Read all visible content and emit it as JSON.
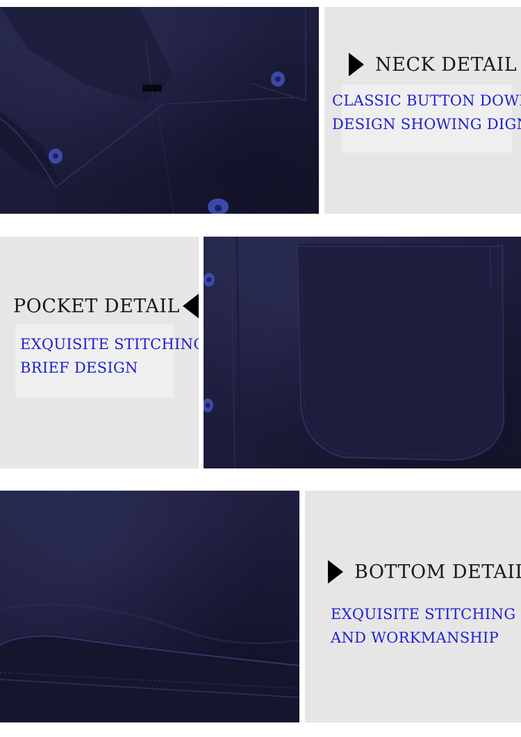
{
  "colors": {
    "fabric": "#1c1d3b",
    "panel_grey": "#e6e6e6",
    "heading_text": "#1a1a1a",
    "description_text": "#1f1fd0",
    "button": "#3b4aa8"
  },
  "sections": {
    "neck": {
      "title": "NECK DETAIL",
      "line1": "CLASSIC BUTTON DOWN",
      "line2": "DESIGN SHOWING DIGNITY",
      "icon": "triangle-right-icon"
    },
    "pocket": {
      "title": "POCKET DETAIL",
      "line1": "EXQUISITE STITCHING",
      "line2": "BRIEF DESIGN",
      "icon": "triangle-left-icon"
    },
    "bottom": {
      "title": "BOTTOM DETAIL",
      "line1": "EXQUISITE STITCHING",
      "line2": "AND WORKMANSHIP",
      "icon": "triangle-right-icon"
    }
  }
}
